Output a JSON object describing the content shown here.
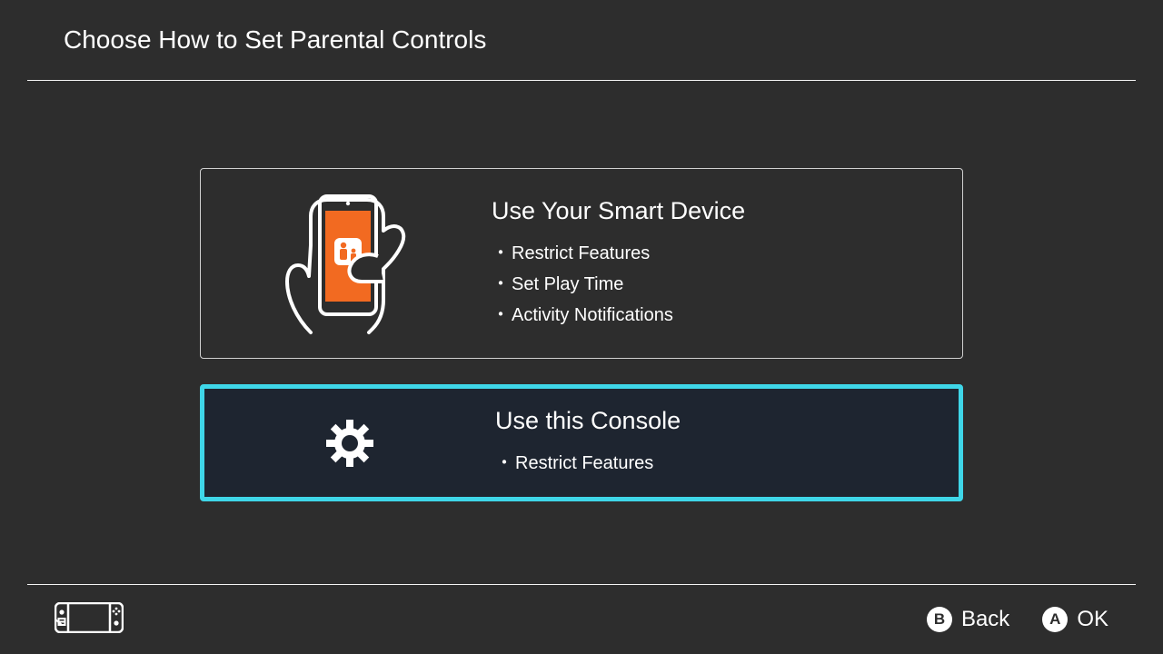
{
  "header": {
    "title": "Choose How to Set Parental Controls"
  },
  "options": [
    {
      "title": "Use Your Smart Device",
      "features": [
        "Restrict Features",
        "Set Play Time",
        "Activity Notifications"
      ],
      "selected": false
    },
    {
      "title": "Use this Console",
      "features": [
        "Restrict Features"
      ],
      "selected": true
    }
  ],
  "footer": {
    "hints": [
      {
        "button": "B",
        "label": "Back"
      },
      {
        "button": "A",
        "label": "OK"
      }
    ]
  },
  "colors": {
    "accent_orange": "#f26a21",
    "highlight_cyan": "#3fd6e8",
    "background": "#2d2d2d",
    "selected_bg": "#1e2530"
  }
}
